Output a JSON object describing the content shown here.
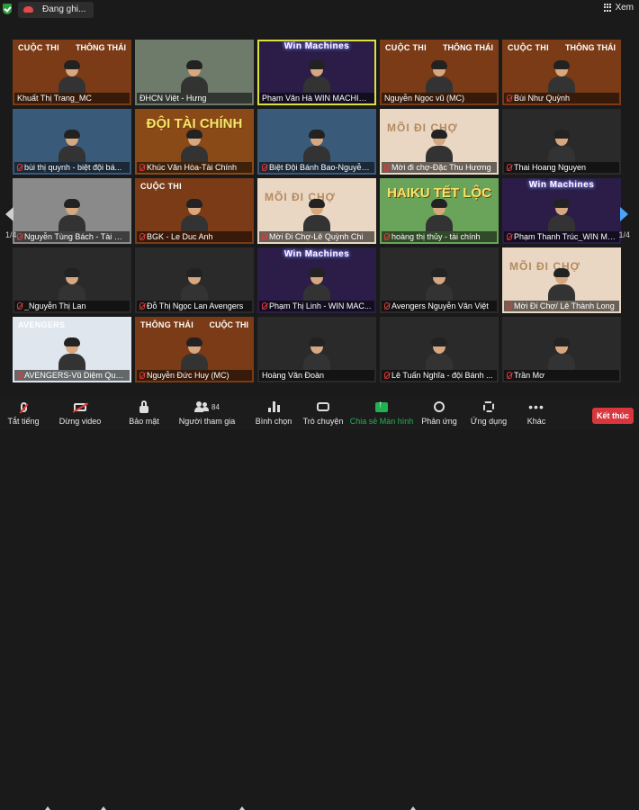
{
  "topbar": {
    "recording_label": "Đang ghi...",
    "view_label": "Xem"
  },
  "pager": {
    "left": "1/4",
    "right": "1/4"
  },
  "tiles": [
    {
      "name": "Khuất Thị Trang_MC",
      "muted": false,
      "bg": "#7a3b16",
      "banner": "CUỘC THI",
      "banner2": "THÔNG THÁI"
    },
    {
      "name": "ĐHCN Việt - Hưng",
      "muted": false,
      "bg": "#6e7a6a"
    },
    {
      "name": "Phạm Văn Hà WIN MACHINES",
      "muted": false,
      "bg": "#2b1d48",
      "banner": "Win Machines",
      "style": "winm",
      "active": true
    },
    {
      "name": "Nguyễn Ngọc vũ (MC)",
      "muted": false,
      "bg": "#7a3b16",
      "banner": "CUỘC THI",
      "banner2": "THÔNG THÁI"
    },
    {
      "name": "Bùi Như Quỳnh",
      "muted": true,
      "bg": "#7a3b16",
      "banner": "CUỘC THI",
      "banner2": "THÔNG THÁI"
    },
    {
      "name": "bùi thị quynh - biệt đội bá...",
      "muted": true,
      "bg": "#3a5a7a"
    },
    {
      "name": "Khúc Văn Hòa-Tài Chính",
      "muted": true,
      "bg": "#8a4a18",
      "banner": "ĐỘI TÀI CHÍNH",
      "style": "big"
    },
    {
      "name": "Biệt Đội Bánh Bao-Nguyễn ...",
      "muted": true,
      "bg": "#3a5a7a"
    },
    {
      "name": "Mời đi chợ-Đặc Thu Hương",
      "muted": true,
      "bg": "#e9d7c4",
      "banner": "MÕI ĐI CHỢ",
      "style": "mdc"
    },
    {
      "name": "Thai Hoang Nguyen",
      "muted": true,
      "bg": "#2a2a2a"
    },
    {
      "name": "Nguyễn Tùng Bách - Tài Ch...",
      "muted": true,
      "bg": "#8a8a8a"
    },
    {
      "name": "BGK - Le Duc Anh",
      "muted": true,
      "bg": "#7a3b16",
      "banner": "CUỘC THI"
    },
    {
      "name": "Mời Đi Chợ-Lê Quỳnh Chi",
      "muted": true,
      "bg": "#e9d7c4",
      "banner": "MÕI ĐI CHỢ",
      "style": "mdc"
    },
    {
      "name": "hoàng thị thủy - tài chính",
      "muted": true,
      "bg": "#6aa35a",
      "banner": "HAIKU TẾT LỘC",
      "style": "big"
    },
    {
      "name": "Phạm Thanh Trúc_WIN MA...",
      "muted": true,
      "bg": "#2b1d48",
      "banner": "Win Machines",
      "style": "winm"
    },
    {
      "name": "_Nguyễn Thị Lan",
      "muted": true,
      "bg": "#2a2a2a"
    },
    {
      "name": "Đỗ Thị Ngọc Lan Avengers",
      "muted": true,
      "bg": "#2a2a2a"
    },
    {
      "name": "Phạm Thị Linh - WIN MAC...",
      "muted": true,
      "bg": "#2b1d48",
      "banner": "Win Machines",
      "style": "winm"
    },
    {
      "name": "Avengers Nguyễn Văn Việt",
      "muted": true,
      "bg": "#2a2a2a"
    },
    {
      "name": "Mời Đi Chợ/ Lê Thành Long",
      "muted": true,
      "bg": "#e9d7c4",
      "banner": "MÕI ĐI CHỢ",
      "style": "mdc"
    },
    {
      "name": "AVENGERS-Vũ Diệm Quỳnh",
      "muted": true,
      "bg": "#dfe6ee",
      "banner": "AVENGERS"
    },
    {
      "name": "Nguyễn Đức Huy (MC)",
      "muted": true,
      "bg": "#7a3b16",
      "banner": "THÔNG THÁI",
      "banner2": "CUỘC THI"
    },
    {
      "name": "Hoàng Văn Đoàn",
      "muted": false,
      "bg": "#2a2a2a"
    },
    {
      "name": "Lê Tuấn Nghĩa - đội Bánh ...",
      "muted": true,
      "bg": "#2a2a2a"
    },
    {
      "name": "Trần Mơ",
      "muted": true,
      "bg": "#2a2a2a"
    }
  ],
  "toolbar": {
    "mute": "Tắt tiếng",
    "stop_video": "Dừng video",
    "security": "Bảo mật",
    "participants": "Người tham gia",
    "participants_count": "84",
    "polls": "Bình chọn",
    "chat": "Trò chuyện",
    "share": "Chia sẻ Màn hình",
    "reactions": "Phản ứng",
    "apps": "Ứng dụng",
    "more": "Khác",
    "end": "Kết thúc"
  },
  "colors": {
    "share_green": "#1fb251",
    "end_red": "#d9363e",
    "active_speaker": "#dde23a",
    "muted_red": "#e03b3b"
  }
}
